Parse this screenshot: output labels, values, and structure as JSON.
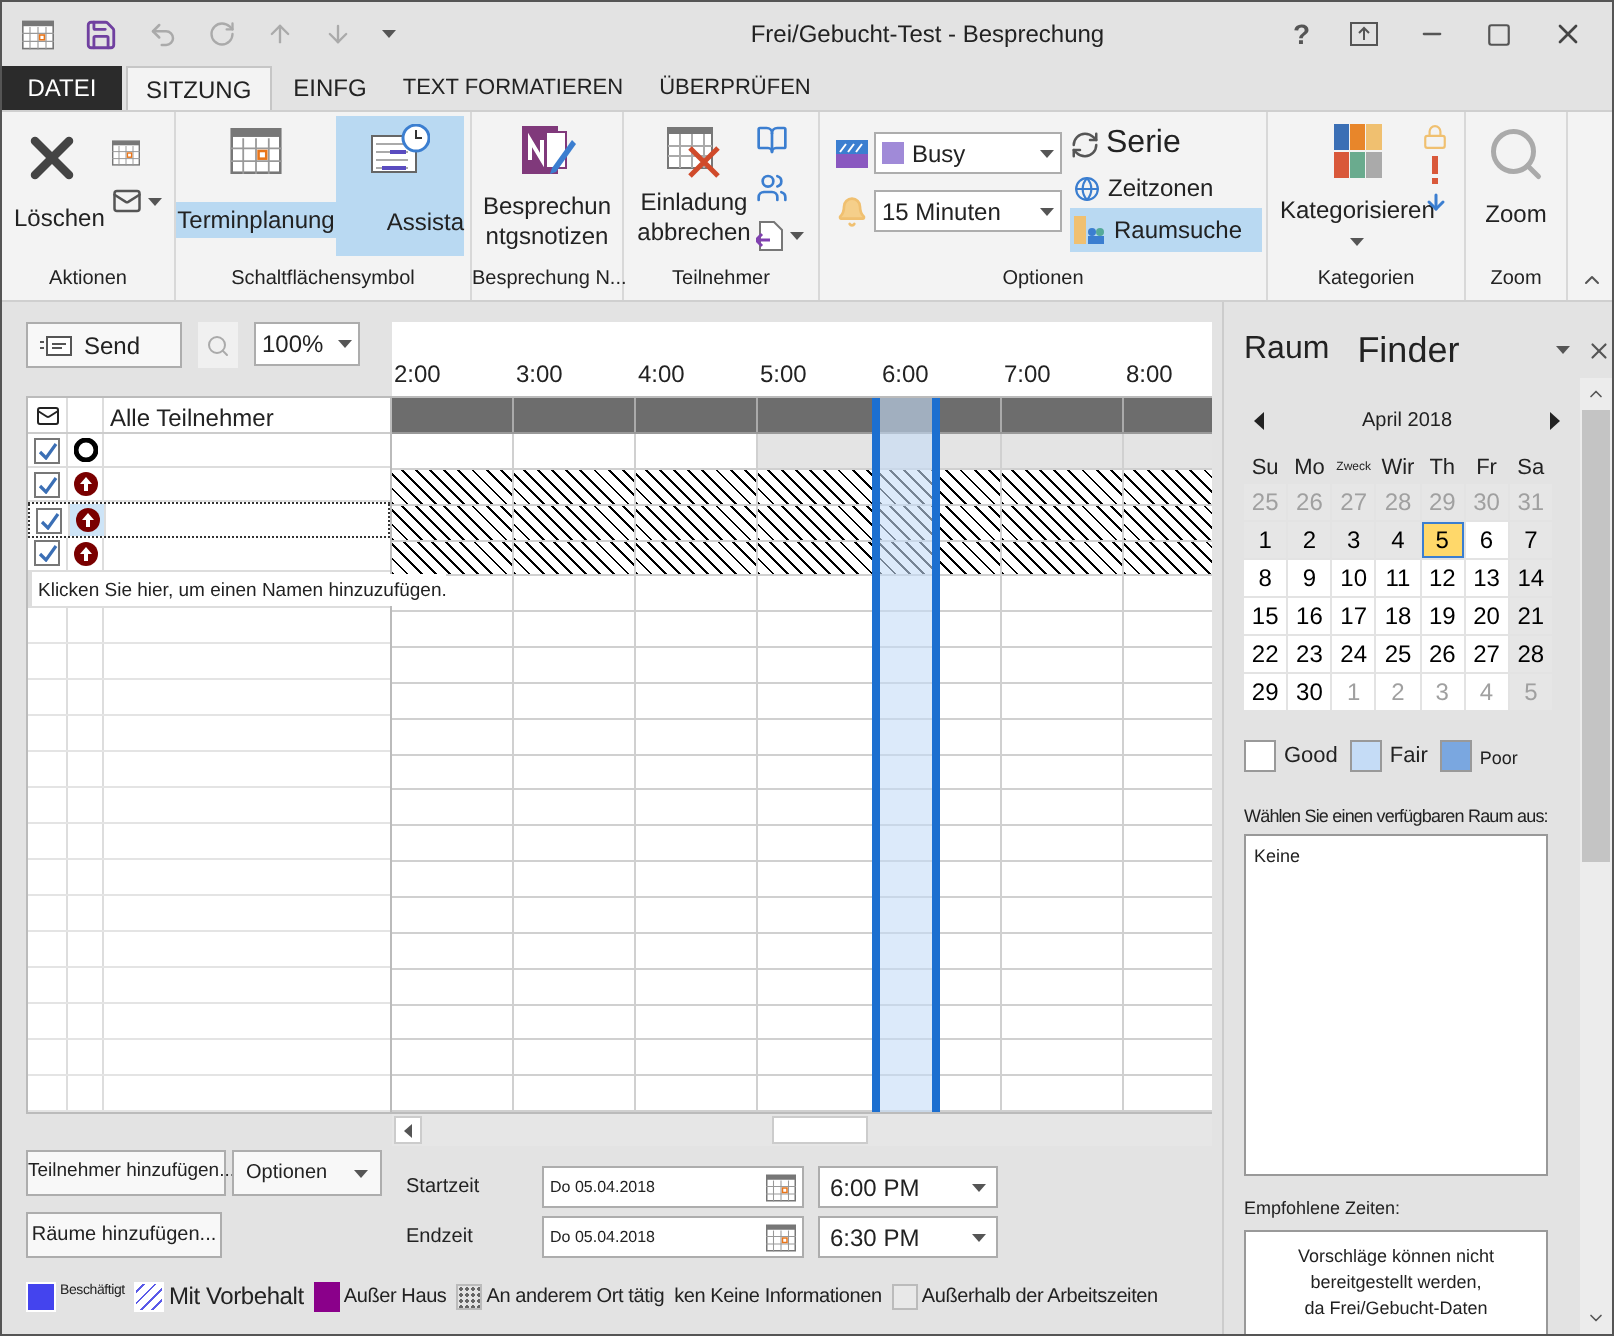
{
  "window": {
    "title": "Frei/Gebucht-Test - Besprechung",
    "help": "?"
  },
  "tabs": [
    {
      "label": "DATEI",
      "kind": "file",
      "selected": false
    },
    {
      "label": "SITZUNG",
      "kind": "tab",
      "selected": true
    },
    {
      "label": "EINFG",
      "kind": "tab",
      "selected": false
    },
    {
      "label": "TEXT FORMATIEREN",
      "kind": "tab",
      "selected": false
    },
    {
      "label": "ÜBERPRÜFEN",
      "kind": "tab",
      "selected": false
    }
  ],
  "ribbon": {
    "actions_group": {
      "label": "Aktionen",
      "delete_button": "Löschen"
    },
    "show_group": {
      "label": "Schaltflächensymbol",
      "scheduling_button": {
        "label": "Terminplanung",
        "selected": true
      },
      "assistant_button": {
        "label": "Assista",
        "selected": true
      }
    },
    "notes_group": {
      "label": "Besprechung N...",
      "notes_button": {
        "line_1": "Besprechun",
        "line_2": "ntgsnotizen"
      }
    },
    "attendees_group": {
      "label": "Teilnehmer",
      "cancel_button": {
        "line_1": "Einladung",
        "line_2": "abbrechen"
      }
    },
    "options_group": {
      "label": "Optionen",
      "show_as": "Busy",
      "reminder": "15 Minuten",
      "recurrence_button": "Serie",
      "time_zones_button": "Zeitzonen",
      "room_finder_button": {
        "label": "Raumsuche",
        "selected": true
      }
    },
    "tags_group": {
      "label": "Kategorien",
      "categorize_button": "Kategorisieren"
    },
    "zoom_group": {
      "label": "Zoom",
      "zoom_button": "Zoom"
    }
  },
  "scheduler": {
    "send_button": "Send",
    "zoom_select": "100%",
    "time_labels": [
      "2:00",
      "3:00",
      "4:00",
      "5:00",
      "6:00",
      "7:00",
      "8:00"
    ],
    "all_attendees": "Alle Teilnehmer",
    "attendees": [
      {
        "kind": "organizer",
        "checked": true,
        "selected": false
      },
      {
        "kind": "required",
        "checked": true,
        "selected": false
      },
      {
        "kind": "required",
        "checked": true,
        "selected": true
      },
      {
        "kind": "required",
        "checked": true,
        "selected": false
      }
    ],
    "timeline_rows": [
      {
        "kind": "off_hours"
      },
      {
        "kind": "no_info"
      },
      {
        "kind": "no_info"
      },
      {
        "kind": "no_info"
      }
    ],
    "add_name_hint": "Klicken Sie hier, um einen Namen hinzuzufügen."
  },
  "bottom": {
    "add_attendees_button": "Teilnehmer hinzufügen...",
    "options_button": "Optionen",
    "add_rooms_button": "Räume hinzufügen...",
    "start": {
      "label": "Startzeit",
      "date": "Do 05.04.2018",
      "time": "6:00 PM"
    },
    "end": {
      "label": "Endzeit",
      "date": "Do 05.04.2018",
      "time": "6:30 PM"
    },
    "legend": [
      {
        "label": "Beschäftigt",
        "kind": "busy"
      },
      {
        "label": "Mit Vorbehalt",
        "kind": "tentative"
      },
      {
        "label": "Außer Haus",
        "kind": "away"
      },
      {
        "label": "An anderem Ort tätig",
        "kind": "elsewhere"
      },
      {
        "label": "ken Keine Informationen",
        "kind": "no_info"
      },
      {
        "label": "Außerhalb der Arbeitszeiten",
        "kind": "off_hours"
      }
    ]
  },
  "room_finder": {
    "title_1": "Raum",
    "title_2": "Finder",
    "month": "April 2018",
    "weekdays": [
      {
        "label": "Su",
        "kind": "normal"
      },
      {
        "label": "Mo",
        "kind": "normal"
      },
      {
        "label": "Zweck",
        "kind": "small"
      },
      {
        "label": "Wir",
        "kind": "normal"
      },
      {
        "label": "Th",
        "kind": "normal"
      },
      {
        "label": "Fr",
        "kind": "normal"
      },
      {
        "label": "Sa",
        "kind": "normal"
      }
    ],
    "weeks": [
      [
        {
          "day": "25",
          "kind": "other",
          "selected": false
        },
        {
          "day": "26",
          "kind": "other",
          "selected": false
        },
        {
          "day": "27",
          "kind": "other",
          "selected": false
        },
        {
          "day": "28",
          "kind": "other",
          "selected": false
        },
        {
          "day": "29",
          "kind": "other",
          "selected": false
        },
        {
          "day": "30",
          "kind": "other",
          "selected": false
        },
        {
          "day": "31",
          "kind": "other",
          "selected": false
        }
      ],
      [
        {
          "day": "1",
          "kind": "shaded",
          "selected": false
        },
        {
          "day": "2",
          "kind": "shaded",
          "selected": false
        },
        {
          "day": "3",
          "kind": "shaded",
          "selected": false
        },
        {
          "day": "4",
          "kind": "shaded",
          "selected": false
        },
        {
          "day": "5",
          "kind": "good",
          "selected": true
        },
        {
          "day": "6",
          "kind": "good",
          "selected": false
        },
        {
          "day": "7",
          "kind": "shaded",
          "selected": false
        }
      ],
      [
        {
          "day": "8",
          "kind": "good",
          "selected": false
        },
        {
          "day": "9",
          "kind": "good",
          "selected": false
        },
        {
          "day": "10",
          "kind": "good",
          "selected": false
        },
        {
          "day": "11",
          "kind": "good",
          "selected": false
        },
        {
          "day": "12",
          "kind": "good",
          "selected": false
        },
        {
          "day": "13",
          "kind": "good",
          "selected": false
        },
        {
          "day": "14",
          "kind": "shaded",
          "selected": false
        }
      ],
      [
        {
          "day": "15",
          "kind": "good",
          "selected": false
        },
        {
          "day": "16",
          "kind": "good",
          "selected": false
        },
        {
          "day": "17",
          "kind": "good",
          "selected": false
        },
        {
          "day": "18",
          "kind": "good",
          "selected": false
        },
        {
          "day": "19",
          "kind": "good",
          "selected": false
        },
        {
          "day": "20",
          "kind": "good",
          "selected": false
        },
        {
          "day": "21",
          "kind": "shaded",
          "selected": false
        }
      ],
      [
        {
          "day": "22",
          "kind": "good",
          "selected": false
        },
        {
          "day": "23",
          "kind": "good",
          "selected": false
        },
        {
          "day": "24",
          "kind": "good",
          "selected": false
        },
        {
          "day": "25",
          "kind": "good",
          "selected": false
        },
        {
          "day": "26",
          "kind": "good",
          "selected": false
        },
        {
          "day": "27",
          "kind": "good",
          "selected": false
        },
        {
          "day": "28",
          "kind": "shaded",
          "selected": false
        }
      ],
      [
        {
          "day": "29",
          "kind": "good",
          "selected": false
        },
        {
          "day": "30",
          "kind": "good",
          "selected": false
        },
        {
          "day": "1",
          "kind": "next",
          "selected": false
        },
        {
          "day": "2",
          "kind": "next",
          "selected": false
        },
        {
          "day": "3",
          "kind": "next",
          "selected": false
        },
        {
          "day": "4",
          "kind": "next",
          "selected": false
        },
        {
          "day": "5",
          "kind": "other",
          "selected": false
        }
      ]
    ],
    "legend": [
      {
        "label": "Good",
        "color": "#ffffff",
        "kind": "large"
      },
      {
        "label": "Fair",
        "color": "#c5dcf6",
        "kind": "large"
      },
      {
        "label": "Poor",
        "color": "#7aa7e0",
        "kind": "small"
      }
    ],
    "choose_room_label": "Wählen Sie einen verfügbaren Raum aus:",
    "rooms": [
      "Keine"
    ],
    "suggested_label": "Empfohlene Zeiten:",
    "suggestion_lines": [
      "Vorschläge können nicht",
      "bereitgestellt werden,",
      "da Frei/Gebucht-Daten"
    ]
  }
}
